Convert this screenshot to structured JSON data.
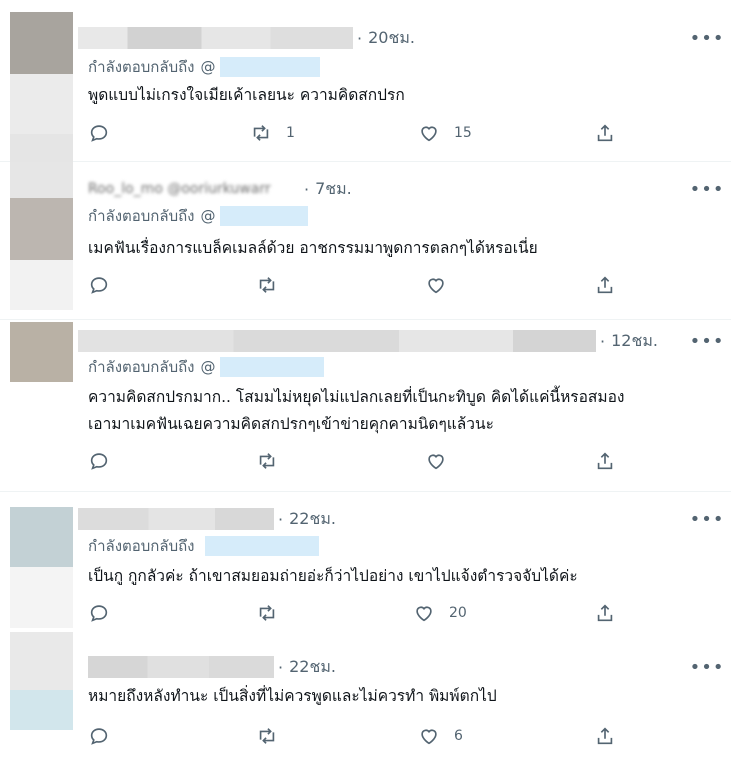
{
  "reply_prefix": "กำลังตอบกลับถึง",
  "reply_at": "@",
  "tweets": [
    {
      "time": "20ชม.",
      "handle_fragment": "ฺ  ้   ‿         ‿ ‿  ‿ ‿ ‿  ‿ x",
      "text_lines": [
        "พูดแบบไม่เกรงใจเมียเค้าเลยนะ ความคิดสกปรก"
      ],
      "retweets": "1",
      "likes": "15"
    },
    {
      "time": "7ชม.",
      "handle_fragment": "Roo_lo_mo @ooriurkuwarr",
      "text_lines": [
        "เมคฟันเรื่องการแบล็คเมลล์ด้วย อาชกรรมมาพูดการตลกๆได้หรอเนี่ย"
      ],
      "retweets": "",
      "likes": ""
    },
    {
      "time": "12ชม.",
      "handle_fragment": "",
      "text_lines": [
        "ความคิดสกปรกมาก..  โสมมไม่หยุดไม่แปลกเลยที่เป็นกะทิบูด คิดได้แค่นี้หรอสมอง",
        "เอามาเมคฟันเฉยความคิดสกปรกๆเข้าข่ายคุกคามนิดๆแล้วนะ"
      ],
      "retweets": "",
      "likes": ""
    },
    {
      "time": "22ชม.",
      "handle_fragment": "",
      "text_lines": [
        "เป็นกู กูกลัวค่ะ ถ้าเขาสมยอมถ่ายอ่ะก็ว่าไปอย่าง เขาไปแจ้งตำรวจจับได้ค่ะ"
      ],
      "retweets": "",
      "likes": "20"
    },
    {
      "time": "22ชม.",
      "handle_fragment": "",
      "text_lines": [
        "หมายถึงหลังทำนะ เป็นสิ่งที่ไม่ควรพูดและไม่ควรทำ พิมพ์ตกไป"
      ],
      "retweets": "",
      "likes": "6"
    }
  ],
  "icons": {
    "more": "more-icon",
    "reply": "reply-icon",
    "retweet": "retweet-icon",
    "like": "heart-icon",
    "share": "share-icon"
  },
  "colors": {
    "muted_text": "#536471",
    "blur_mention": "#d6ecfa",
    "divider": "#eff3f4"
  }
}
